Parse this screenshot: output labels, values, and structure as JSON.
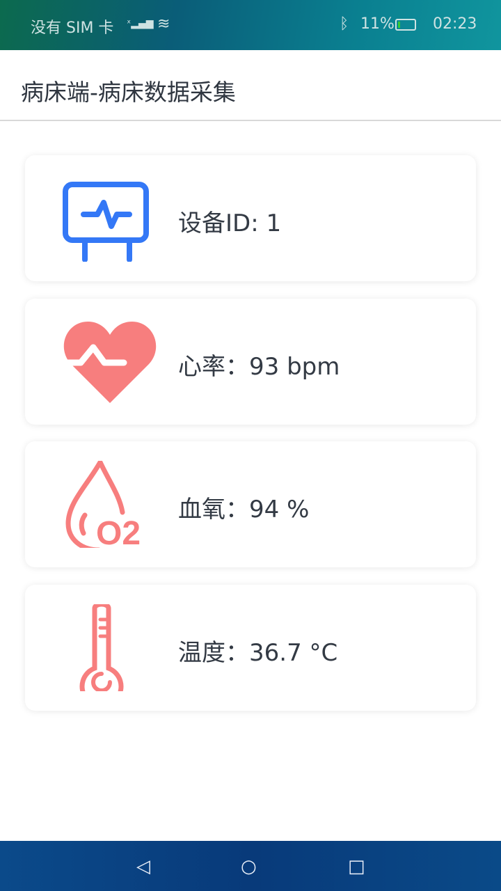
{
  "status_bar": {
    "carrier": "没有 SIM 卡",
    "battery": "11%",
    "time": "02:23"
  },
  "app_bar": {
    "title": "病床端-病床数据采集"
  },
  "cards": [
    {
      "icon": "monitor-icon",
      "label": "设备ID:  1"
    },
    {
      "icon": "heart-rate-icon",
      "label": "心率：93 bpm"
    },
    {
      "icon": "blood-oxygen-icon",
      "label": "血氧：94 %"
    },
    {
      "icon": "thermometer-icon",
      "label": "温度：36.7 °C"
    }
  ],
  "colors": {
    "blue": "#3478f6",
    "red": "#f77e7e"
  }
}
